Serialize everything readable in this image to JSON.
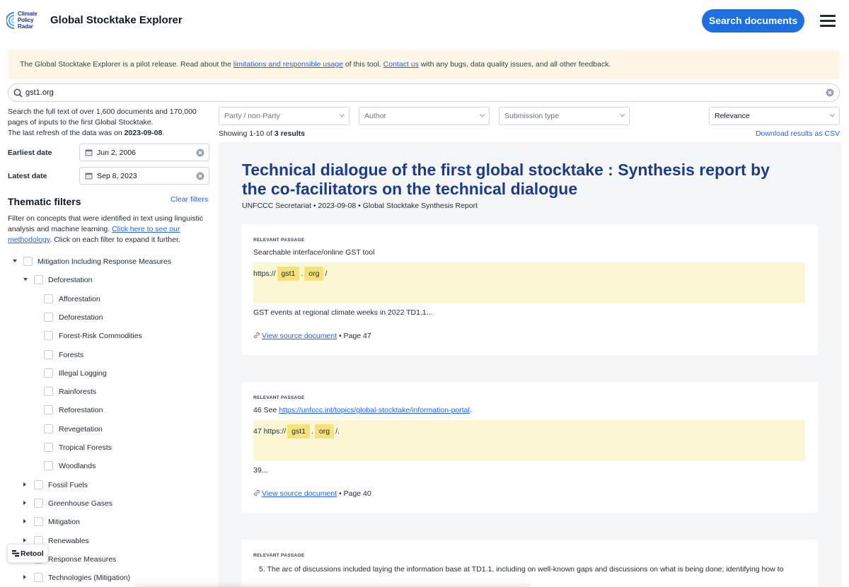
{
  "header": {
    "logo_text": [
      "Climate",
      "Policy",
      "Radar"
    ],
    "app_title": "Global Stocktake Explorer",
    "search_button": "Search documents",
    "menu_icon": "hamburger-menu-icon"
  },
  "banner": {
    "pre": "The Global Stocktake Explorer is a pilot release. Read about the ",
    "link1": "limitations and responsible usage",
    "mid": " of this tool. ",
    "link2": "Contact us",
    "post": " with any bugs, data quality issues, and all other feedback."
  },
  "search": {
    "value": "gst1.org",
    "icon": "search-icon"
  },
  "sidebar": {
    "intro_1": "Search the full text of over 1,600 documents and 170,000 pages of inputs to the first Global Stocktake.",
    "intro_2": "The last refresh of the data was on ",
    "intro_date": "2023-09-08",
    "earliest_label": "Earliest date",
    "earliest_value": "Jun 2, 2006",
    "latest_label": "Latest date",
    "latest_value": "Sep 8, 2023",
    "thematic_title": "Thematic filters",
    "clear_filters": "Clear filters",
    "filter_desc_1": "Filter on concepts that were identified in text using linguistic analysis and machine learning. ",
    "filter_desc_link": "Click here to see our methodology",
    "filter_desc_2": ". Click on each filter to expand it further.",
    "tree": [
      {
        "label": "Mitigation Including Response Measures",
        "level": 0,
        "caret": "down"
      },
      {
        "label": "Deforestation",
        "level": 1,
        "caret": "down"
      },
      {
        "label": "Afforestation",
        "level": 2,
        "caret": "none"
      },
      {
        "label": "Deforestation",
        "level": 2,
        "caret": "none"
      },
      {
        "label": "Forest-Risk Commodities",
        "level": 2,
        "caret": "none"
      },
      {
        "label": "Forests",
        "level": 2,
        "caret": "none"
      },
      {
        "label": "Illegal Logging",
        "level": 2,
        "caret": "none"
      },
      {
        "label": "Rainforests",
        "level": 2,
        "caret": "none"
      },
      {
        "label": "Reforestation",
        "level": 2,
        "caret": "none"
      },
      {
        "label": "Revegetation",
        "level": 2,
        "caret": "none"
      },
      {
        "label": "Tropical Forests",
        "level": 2,
        "caret": "none"
      },
      {
        "label": "Woodlands",
        "level": 2,
        "caret": "none"
      },
      {
        "label": "Fossil Fuels",
        "level": 1,
        "caret": "right"
      },
      {
        "label": "Greenhouse Gases",
        "level": 1,
        "caret": "right"
      },
      {
        "label": "Mitigation",
        "level": 1,
        "caret": "right"
      },
      {
        "label": "Renewables",
        "level": 1,
        "caret": "right"
      },
      {
        "label": "Response Measures",
        "level": 1,
        "caret": "right"
      },
      {
        "label": "Technologies (Mitigation)",
        "level": 1,
        "caret": "right"
      }
    ],
    "retool_label": "Retool"
  },
  "filters": {
    "party": "Party / non-Party",
    "author": "Author",
    "submission": "Submission type",
    "sort": "Relevance"
  },
  "results_bar": {
    "showing_pre": "Showing 1-10 of ",
    "showing_count": "3 results",
    "download": "Download results as CSV"
  },
  "document": {
    "title": "Technical dialogue of the first global stocktake : Synthesis report by the co-facilitators on the technical dialogue",
    "meta": "UNFCCC Secretariat • 2023-09-08 • Global Stocktake Synthesis Report"
  },
  "passages": [
    {
      "label": "RELEVANT PASSAGE",
      "line1": "Searchable interface/online GST tool",
      "hl_pre": "https://",
      "chip1": "gst1",
      "hl_dot": ".",
      "chip2": "org",
      "hl_post": "/",
      "line2": "GST events at regional climate weeks in 2022 TD1.1...",
      "view_source": "View source document",
      "page": " • Page 47"
    },
    {
      "label": "RELEVANT PASSAGE",
      "line1_pre": "46 See ",
      "line1_link": "https://unfccc.int/topics/global-stocktake/information-portal",
      "line1_post": ".",
      "hl_pre": "47 https://",
      "chip1": "gst1",
      "hl_dot": ".",
      "chip2": "org",
      "hl_post": "/.",
      "line2": "39...",
      "view_source": "View source document",
      "page": " • Page 40"
    },
    {
      "label": "RELEVANT PASSAGE",
      "line1": "5.   The arc of discussions included laying the information base at TD1.1, including on well-known gaps and discussions on what is being done; identifying how to"
    }
  ]
}
